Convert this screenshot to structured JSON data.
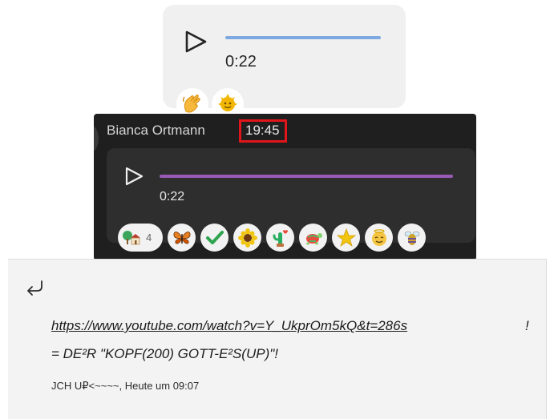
{
  "voice_message_light": {
    "duration": "0:22",
    "progress_color": "#7ea9e0",
    "reactions": [
      {
        "icon": "waving-hand-icon"
      },
      {
        "icon": "sun-face-icon"
      }
    ]
  },
  "voice_message_dark": {
    "sender": "Bianca Ortmann",
    "timestamp": "19:45",
    "highlight_color": "#e0161b",
    "duration": "0:22",
    "progress_color": "#9b59b6",
    "reactions": [
      {
        "icon": "house-with-tree-icon",
        "count": "4"
      },
      {
        "icon": "butterfly-icon"
      },
      {
        "icon": "check-mark-icon"
      },
      {
        "icon": "sunflower-icon"
      },
      {
        "icon": "cactus-with-heart-icon"
      },
      {
        "icon": "turtle-icon"
      },
      {
        "icon": "star-icon"
      },
      {
        "icon": "smiling-face-icon"
      },
      {
        "icon": "bee-icon"
      }
    ]
  },
  "reply_preview": {
    "icon": "reply-arrow-icon",
    "link": "https://www.youtube.com/watch?v=Y_UkprOm5kQ&t=286s",
    "link_tail": "!",
    "formula": "= DE²R \"KOPF(200) GOTT-E²S(UP)\"!",
    "meta": "JCH U₽<~~~~, Heute um 09:07"
  }
}
